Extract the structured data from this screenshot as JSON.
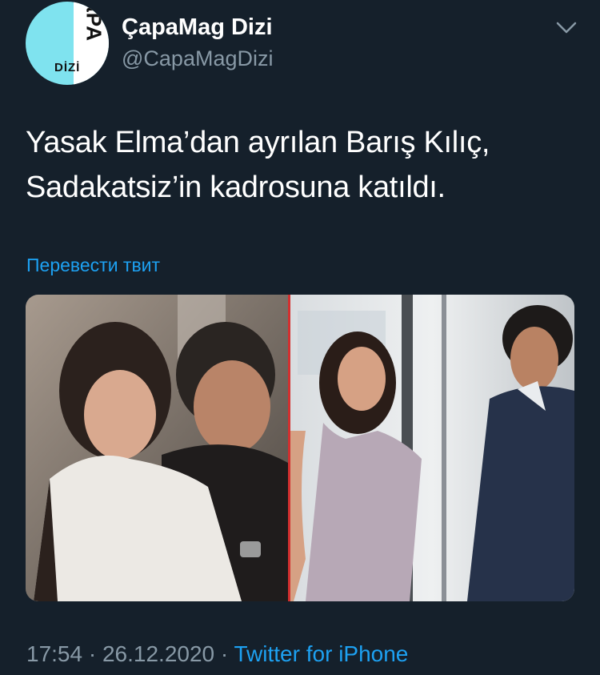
{
  "author": {
    "display_name": "ÇapaMag Dizi",
    "handle": "@CapaMagDizi",
    "avatar_text_top": "ÇaPA",
    "avatar_text_bottom": "DİZİ"
  },
  "tweet": {
    "line1": "Yasak Elma’dan ayrılan Barış Kılıç,",
    "line2": "Sadakatsiz’in kadrosuna katıldı.",
    "translate_label": "Перевести твит"
  },
  "meta": {
    "time": "17:54",
    "separator": " · ",
    "date": "26.12.2020",
    "source": "Twitter for iPhone"
  },
  "icons": {
    "menu": "chevron-down-icon"
  },
  "colors": {
    "background": "#15202b",
    "link": "#1da1f2",
    "secondary_text": "#8899a6",
    "photo_divider": "#d32f2f"
  }
}
